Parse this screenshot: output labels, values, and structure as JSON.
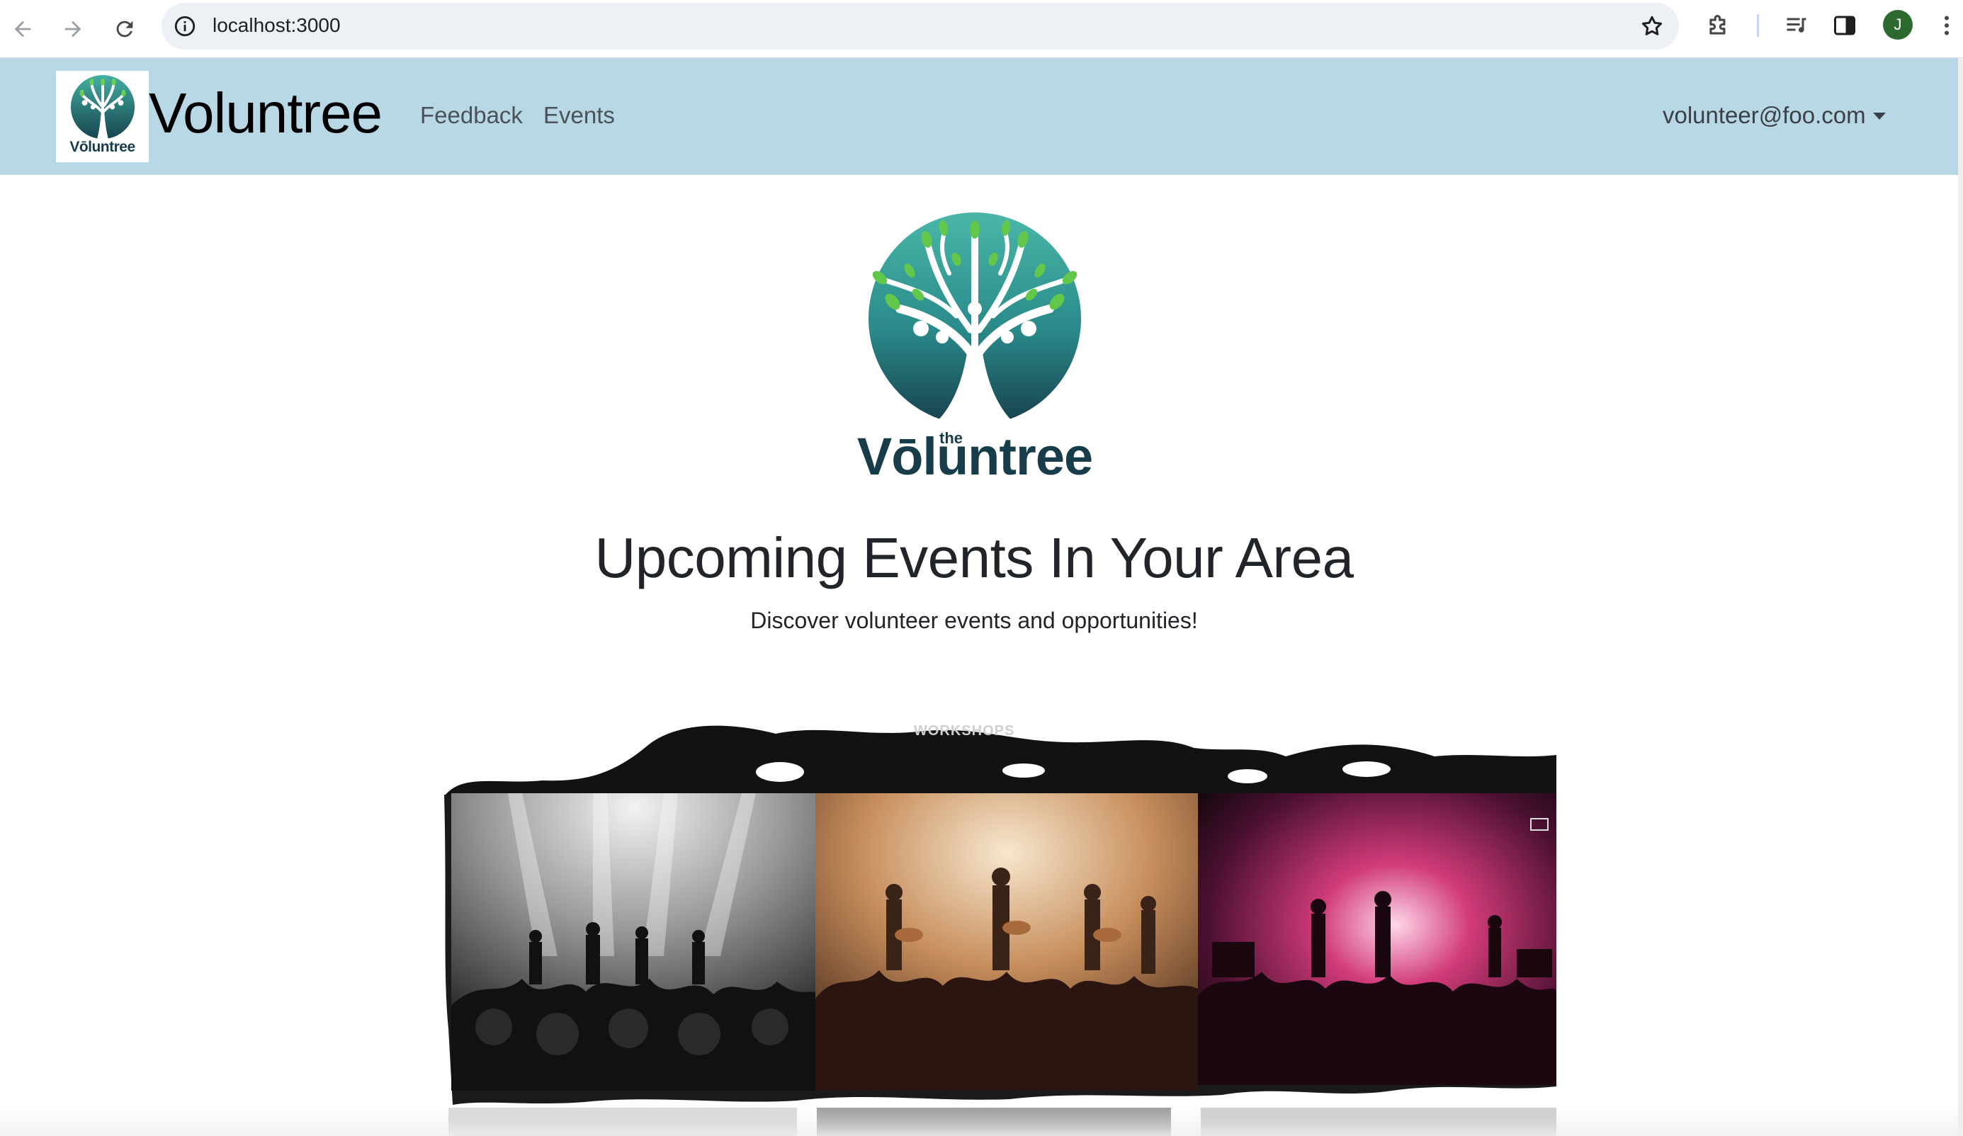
{
  "browser": {
    "url": "localhost:3000",
    "profile_initial": "J",
    "icons": [
      "back-arrow-icon",
      "forward-arrow-icon",
      "reload-icon",
      "site-info-icon",
      "bookmark-star-icon",
      "extensions-puzzle-icon",
      "media-queue-icon",
      "side-panel-icon",
      "kebab-menu-icon"
    ]
  },
  "navbar": {
    "logo_word": "Vōluntree",
    "brand": "Voluntree",
    "links": [
      "Feedback",
      "Events"
    ],
    "user_email": "volunteer@foo.com"
  },
  "hero": {
    "logo_small_word": "the",
    "logo_word": "Vōluntree",
    "title": "Upcoming Events In Your Area",
    "subtitle": "Discover volunteer events and opportunities!"
  },
  "collage": {
    "banner_text": "WORKSHOPS",
    "photos": [
      "concert-photo-monochrome",
      "concert-photo-warm",
      "concert-photo-magenta"
    ]
  },
  "colors": {
    "navbar_bg": "#b7d8e4",
    "logo_teal": "#2f8d8c",
    "logo_dark": "#173d4a",
    "leaf_green": "#5cc244",
    "text_dark": "#212529"
  }
}
